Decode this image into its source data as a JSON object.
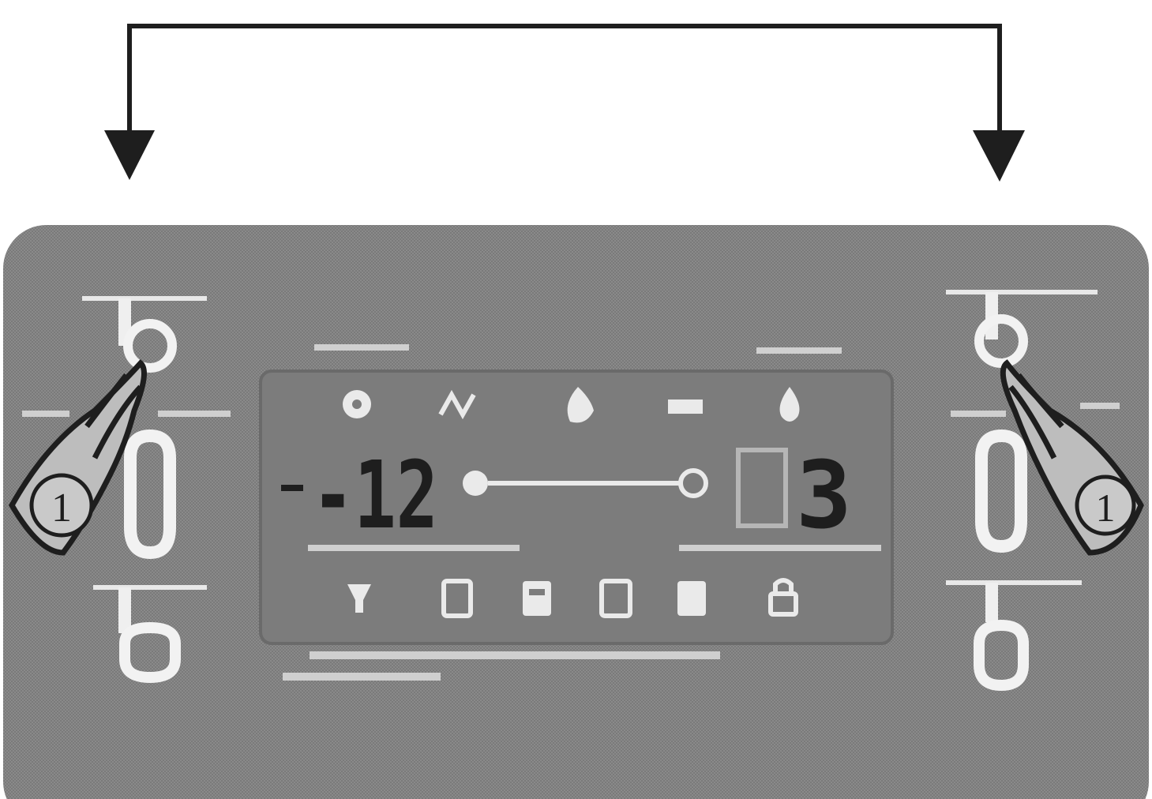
{
  "instruction": {
    "step_marker_left": "1",
    "step_marker_right": "1"
  },
  "display": {
    "freezer_temp": "-12",
    "fridge_temp": "3"
  },
  "colors": {
    "panel": "#8a8a8a",
    "panel_dark": "#6f6f6f",
    "ink": "#1e1e1e",
    "button_outline": "#f2f2f2"
  },
  "icons": {
    "top_row": [
      "fan-icon",
      "wave-icon",
      "flame-icon",
      "snowflake-text-icon",
      "drop-icon"
    ],
    "bottom_row": [
      "filter-icon",
      "cup-icon",
      "ice-bin-icon",
      "cube-icon",
      "crushed-icon",
      "lock-icon"
    ]
  }
}
